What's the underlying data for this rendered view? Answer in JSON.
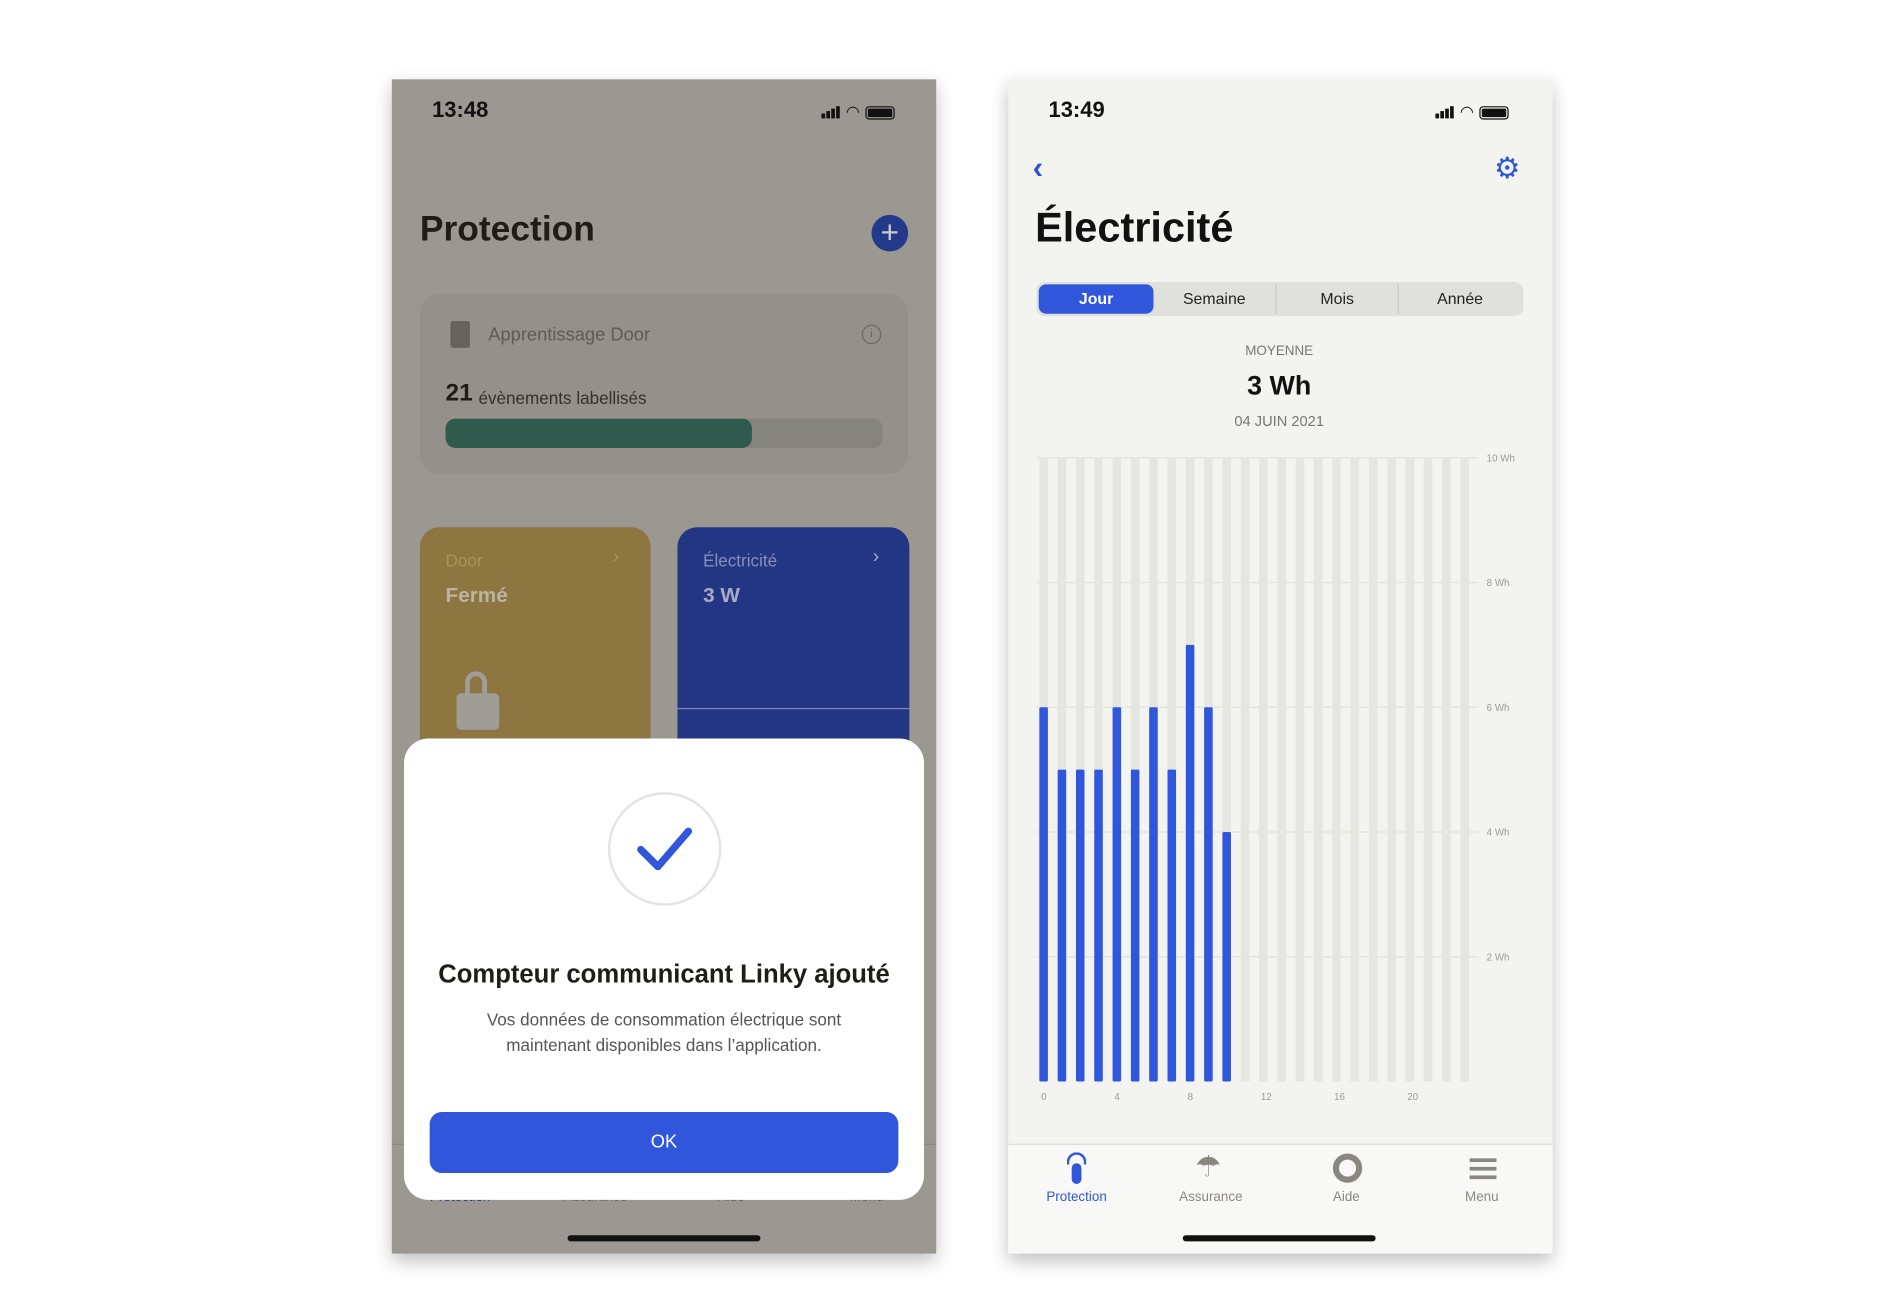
{
  "left_screen": {
    "status_time": "13:48",
    "title": "Protection",
    "learning_card": {
      "title": "Apprentissage Door",
      "count": "21",
      "count_label": "évènements labellisés",
      "progress": 0.7,
      "progress_color": "#2f5a4d"
    },
    "tiles": [
      {
        "label": "Door",
        "value": "Fermé",
        "color": "#8e7640"
      },
      {
        "label": "Électricité",
        "value": "3 W",
        "color": "#233683"
      }
    ],
    "tab_bar": [
      "Protection",
      "Assurance",
      "Aide",
      "Menu"
    ],
    "modal": {
      "title": "Compteur communicant Linky ajouté",
      "body_line1": "Vos données de consommation électrique sont",
      "body_line2": "maintenant disponibles dans l’application.",
      "ok_label": "OK",
      "accent": "#3056dc"
    }
  },
  "right_screen": {
    "status_time": "13:49",
    "title": "Électricité",
    "segments": [
      "Jour",
      "Semaine",
      "Mois",
      "Année"
    ],
    "selected_segment": "Jour",
    "average_label": "MOYENNE",
    "average_value": "3 Wh",
    "date": "04 JUIN 2021",
    "tab_bar": [
      {
        "label": "Protection",
        "icon": "protection-icon",
        "active": true
      },
      {
        "label": "Assurance",
        "icon": "umbrella-icon"
      },
      {
        "label": "Aide",
        "icon": "lifebuoy-icon"
      },
      {
        "label": "Menu",
        "icon": "menu-icon"
      }
    ]
  },
  "chart_data": {
    "type": "bar",
    "x": [
      0,
      1,
      2,
      3,
      4,
      5,
      6,
      7,
      8,
      9,
      10,
      11,
      12,
      13,
      14,
      15,
      16,
      17,
      18,
      19,
      20,
      21,
      22,
      23
    ],
    "values": [
      6,
      5,
      5,
      5,
      6,
      5,
      6,
      5,
      7,
      6,
      4,
      null,
      null,
      null,
      null,
      null,
      null,
      null,
      null,
      null,
      null,
      null,
      null,
      null
    ],
    "x_ticks": [
      "0",
      "4",
      "8",
      "12",
      "16",
      "20"
    ],
    "y_ticks": [
      "2 Wh",
      "4 Wh",
      "6 Wh",
      "8 Wh",
      "10 Wh"
    ],
    "ylim": [
      0,
      10
    ],
    "bar_color": "#3056dc",
    "track_color": "#e6e6e1",
    "grid": true
  }
}
